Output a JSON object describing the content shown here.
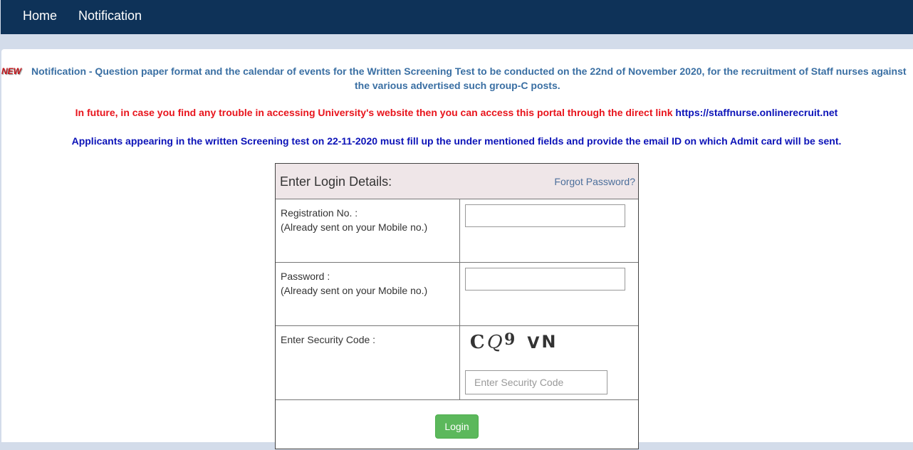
{
  "nav": {
    "items": [
      {
        "label": "Home"
      },
      {
        "label": "Notification"
      }
    ]
  },
  "notification": {
    "badge": "NEW",
    "line1": " Notification - Question paper format and the calendar of events for the Written Screening Test to be conducted on the 22nd of November 2020, for the recruitment of Staff nurses against",
    "line2": "the various advertised such group-C posts."
  },
  "info": {
    "red_text": "In future, in case you find any trouble in accessing University's website then you can access this portal through the direct link ",
    "direct_link": "https://staffnurse.onlinerecruit.net",
    "blue_text": "Applicants appearing in the written Screening test on 22-11-2020 must fill up the under mentioned fields and provide the email ID on which Admit card will be sent."
  },
  "login": {
    "title": "Enter Login Details:",
    "forgot_password": "Forgot Password?",
    "registration_label": "Registration No. :",
    "registration_hint": "(Already sent on your Mobile no.)",
    "registration_value": "",
    "password_label": "Password :",
    "password_hint": "(Already sent on your Mobile no.)",
    "password_value": "",
    "security_label": "Enter Security Code :",
    "captcha_chars": [
      "C",
      "Q",
      "9",
      "V",
      "N"
    ],
    "security_placeholder": "Enter Security Code",
    "security_value": "",
    "login_button": "Login",
    "button_color": "#5cb85c"
  },
  "colors": {
    "navbar": "#0e3258",
    "link": "#3a6fa3",
    "red_notice": "#e8141c",
    "blue_notice": "#0c13b8"
  }
}
